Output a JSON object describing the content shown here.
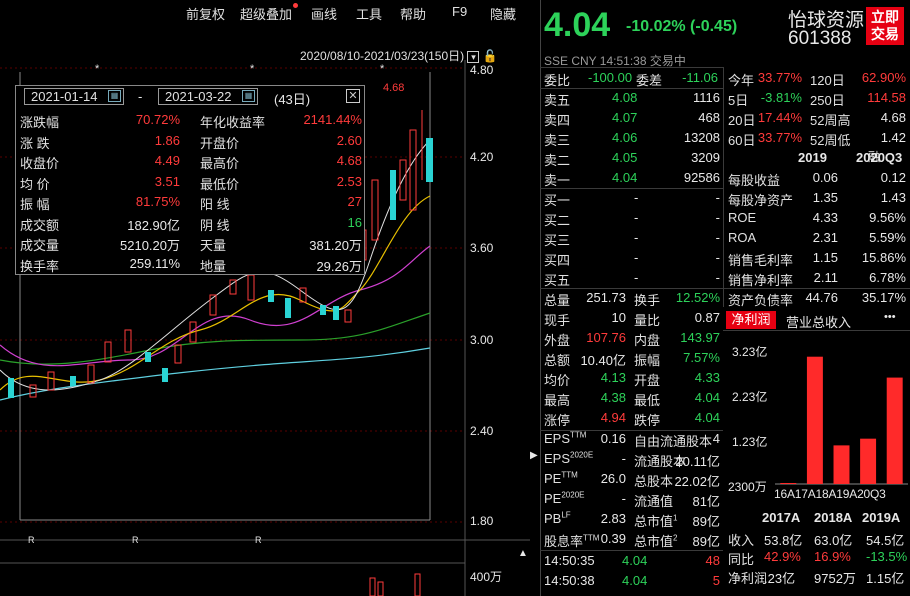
{
  "menu": {
    "items": [
      "前复权",
      "超级叠加",
      "画线",
      "工具",
      "帮助",
      "F9",
      "隐藏"
    ]
  },
  "chart": {
    "date_range": "2020/08/10-2021/03/23(150日)",
    "y_labels": [
      "4.80",
      "4.20",
      "3.60",
      "3.00",
      "2.40",
      "1.80"
    ],
    "vol_label": "400万",
    "peak_label": "4.68",
    "markers": [
      "R",
      "R",
      "R"
    ],
    "stars": [
      "*",
      "*",
      "*"
    ]
  },
  "infobox": {
    "start_date": "2021-01-14",
    "dash": "-",
    "end_date": "2021-03-22",
    "days": "(43日)",
    "rows": [
      {
        "l1": "涨跌幅",
        "v1": "70.72%",
        "l2": "年化收益率",
        "v2": "2141.44%"
      },
      {
        "l1": "涨  跌",
        "v1": "1.86",
        "l2": "开盘价",
        "v2": "2.60"
      },
      {
        "l1": "收盘价",
        "v1": "4.49",
        "l2": "最高价",
        "v2": "4.68"
      },
      {
        "l1": "均  价",
        "v1": "3.51",
        "l2": "最低价",
        "v2": "2.53"
      },
      {
        "l1": "振  幅",
        "v1": "81.75%",
        "l2": "阳  线",
        "v2": "27"
      },
      {
        "l1": "成交额",
        "v1": "182.90亿",
        "l2": "阴  线",
        "v2": "16"
      },
      {
        "l1": "成交量",
        "v1": "5210.20万",
        "l2": "天量",
        "v2": "381.20万"
      },
      {
        "l1": "换手率",
        "v1": "259.11%",
        "l2": "地量",
        "v2": "29.26万"
      }
    ]
  },
  "quote": {
    "price": "4.04",
    "change": "-10.02% (-0.45)",
    "name": "怡球资源",
    "code": "601388",
    "trade_button": "立即\n交易",
    "trade_button_1": "立即",
    "trade_button_2": "交易",
    "meta": "SSE  CNY  14:51:38  交易中",
    "wb_label": "委比",
    "wb_value": "-100.00",
    "wc_label": "委差",
    "wc_value": "-11.06",
    "sells": [
      {
        "label": "卖五",
        "price": "4.08",
        "vol": "1116"
      },
      {
        "label": "卖四",
        "price": "4.07",
        "vol": "468"
      },
      {
        "label": "卖三",
        "price": "4.06",
        "vol": "13208"
      },
      {
        "label": "卖二",
        "price": "4.05",
        "vol": "3209"
      },
      {
        "label": "卖一",
        "price": "4.04",
        "vol": "92586"
      }
    ],
    "buys": [
      {
        "label": "买一",
        "price": "-",
        "vol": "-"
      },
      {
        "label": "买二",
        "price": "-",
        "vol": "-"
      },
      {
        "label": "买三",
        "price": "-",
        "vol": "-"
      },
      {
        "label": "买四",
        "price": "-",
        "vol": "-"
      },
      {
        "label": "买五",
        "price": "-",
        "vol": "-"
      }
    ],
    "stats": [
      {
        "l1": "总量",
        "v1": "251.73",
        "l2": "换手",
        "v2": "12.52%"
      },
      {
        "l1": "现手",
        "v1": "10",
        "l2": "量比",
        "v2": "0.87"
      },
      {
        "l1": "外盘",
        "v1": "107.76",
        "l2": "内盘",
        "v2": "143.97"
      },
      {
        "l1": "总额",
        "v1": "10.40亿",
        "l2": "振幅",
        "v2": "7.57%"
      },
      {
        "l1": "均价",
        "v1": "4.13",
        "l2": "开盘",
        "v2": "4.33"
      },
      {
        "l1": "最高",
        "v1": "4.38",
        "l2": "最低",
        "v2": "4.04"
      },
      {
        "l1": "涨停",
        "v1": "4.94",
        "l2": "跌停",
        "v2": "4.04"
      }
    ],
    "stats2": [
      {
        "l1": "EPS",
        "sup1": "TTM",
        "v1": "0.16",
        "l2": "自由流通股本",
        "v2": "4"
      },
      {
        "l1": "EPS",
        "sup1": "2020E",
        "v1": "-",
        "l2": "流通股本",
        "v2": "20.11亿"
      },
      {
        "l1": "PE",
        "sup1": "TTM",
        "v1": "26.0",
        "l2": "总股本",
        "v2": "22.02亿"
      },
      {
        "l1": "PE",
        "sup1": "2020E",
        "v1": "-",
        "l2": "流通值",
        "v2": "81亿"
      },
      {
        "l1": "PB",
        "sup1": "LF",
        "v1": "2.83",
        "l2": "总市值",
        "sup2": "1",
        "v2": "89亿"
      },
      {
        "l1": "股息率",
        "sup1": "TTM",
        "v1": "0.39",
        "l2": "总市值",
        "sup2": "2",
        "v2": "89亿"
      }
    ],
    "ticks": [
      {
        "time": "14:50:35",
        "price": "4.04",
        "vol": "48"
      },
      {
        "time": "14:50:38",
        "price": "4.04",
        "vol": "5"
      }
    ]
  },
  "perf": {
    "rows": [
      {
        "l1": "今年",
        "v1": "33.77%",
        "l2": "120日",
        "v2": "62.90%"
      },
      {
        "l1": "5日",
        "v1": "-3.81%",
        "l2": "250日",
        "v2": "114.58"
      },
      {
        "l1": "20日",
        "v1": "17.44%",
        "l2": "52周高",
        "v2": "4.68"
      },
      {
        "l1": "60日",
        "v1": "33.77%",
        "l2": "52周低",
        "v2": "1.42"
      }
    ],
    "rong": "融",
    "fin_headers": [
      "2019",
      "2020Q3"
    ],
    "fin_rows": [
      {
        "label": "每股收益",
        "a": "0.06",
        "b": "0.12"
      },
      {
        "label": "每股净资产",
        "a": "1.35",
        "b": "1.43"
      },
      {
        "label": "ROE",
        "a": "4.33",
        "b": "9.56%"
      },
      {
        "label": "ROA",
        "a": "2.31",
        "b": "5.59%"
      },
      {
        "label": "销售毛利率",
        "a": "1.15",
        "b": "15.86%"
      },
      {
        "label": "销售净利率",
        "a": "2.11",
        "b": "6.78%"
      },
      {
        "label": "资产负债率",
        "a": "44.76",
        "b": "35.17%"
      }
    ],
    "tabs": [
      "净利润",
      "营业总收入"
    ],
    "more": "•••",
    "bottom_headers": [
      "2017A",
      "2018A",
      "2019A"
    ],
    "bottom_rows": [
      {
        "label": "收入",
        "a": "53.8亿",
        "b": "63.0亿",
        "c": "54.5亿"
      },
      {
        "label": "同比",
        "a": "42.9%",
        "b": "16.9%",
        "c": "-13.5%"
      },
      {
        "label": "净利润",
        "a": ".23亿",
        "b": "9752万",
        "c": "1.15亿"
      }
    ]
  },
  "chart_data": {
    "type": "bar",
    "categories": [
      "16A",
      "17A",
      "18A",
      "19A",
      "20Q3"
    ],
    "values": [
      0.02,
      3.23,
      0.98,
      1.15,
      2.7
    ],
    "y_tick_labels": [
      "3.23亿",
      "2.23亿",
      "1.23亿",
      "2300万"
    ],
    "ylim": [
      0,
      3.4
    ]
  }
}
